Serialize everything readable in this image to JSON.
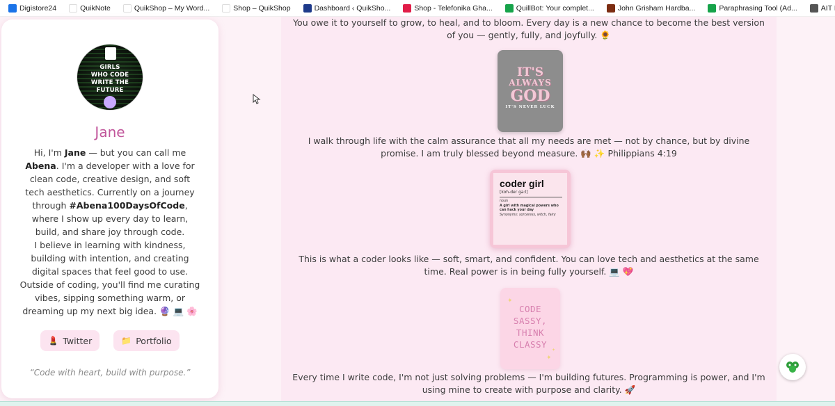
{
  "bookmarks": [
    {
      "label": "Digistore24",
      "icon": "digistore-icon",
      "color": "#1a73e8"
    },
    {
      "label": "QuikNote",
      "icon": "quiknote-icon",
      "color": "#ffffff"
    },
    {
      "label": "QuikShop – My Word...",
      "icon": "quikshop-icon",
      "color": "#ffffff"
    },
    {
      "label": "Shop – QuikShop",
      "icon": "shop-icon",
      "color": "#ffffff"
    },
    {
      "label": "Dashboard ‹ QuikSho...",
      "icon": "s-icon",
      "color": "#1e3a8a"
    },
    {
      "label": "Shop - Telefonika Gha...",
      "icon": "lips-icon",
      "color": "#e11d48"
    },
    {
      "label": "QuillBot: Your complet...",
      "icon": "quillbot-icon",
      "color": "#16a34a"
    },
    {
      "label": "John Grisham Hardba...",
      "icon": "book-icon",
      "color": "#7c2d12"
    },
    {
      "label": "Paraphrasing Tool (Ad...",
      "icon": "paraphrase-icon",
      "color": "#16a34a"
    },
    {
      "label": "AIT LEMASS",
      "icon": "globe-icon",
      "color": "#555555"
    }
  ],
  "profile": {
    "avatar_lines": [
      "GIRLS",
      "WHO CODE",
      "WRITE THE",
      "FUTURE"
    ],
    "name": "Jane",
    "bio": {
      "p1_a": "Hi, I'm ",
      "p1_b": "Jane",
      "p1_c": " — but you can call me ",
      "p1_d": "Abena",
      "p1_e": ". I'm a developer with a love for clean code, creative design, and soft tech aesthetics. Currently on a journey through ",
      "p1_f": "#Abena100DaysOfCode",
      "p1_g": ", where I show up every day to learn, build, and share joy through code.",
      "p2": "I believe in learning with kindness, building with intention, and creating digital spaces that feel good to use.",
      "p3": "Outside of coding, you'll find me curating vibes, sipping something warm, or dreaming up my next big idea. 🔮 💻 🌸"
    },
    "links": [
      {
        "label": "Twitter",
        "icon": "💄"
      },
      {
        "label": "Portfolio",
        "icon": "📁"
      }
    ],
    "quote": "“Code with heart, build with purpose.”"
  },
  "feed": {
    "post1": "You owe it to yourself to grow, to heal, and to bloom. Every day is a new chance to become the best version of you — gently, fully, and joyfully. 🌻",
    "img1": {
      "l1": "IT'S",
      "l2": "ALWAYS",
      "l3": "GOD",
      "l4": "IT'S NEVER LUCK"
    },
    "post2": "I walk through life with the calm assurance that all my needs are met — not by chance, but by divine promise. I am truly blessed beyond measure. 🙌🏾 ✨ Philippians 4:19",
    "img2": {
      "title": "coder girl",
      "pron": "[koh-der gə:l]",
      "pos": "noun",
      "def": "A girl with magical powers who can hack your day",
      "syn": "Synonyms: sorceress, witch, fairy"
    },
    "post3": "This is what a coder looks like — soft, smart, and confident. You can love tech and aesthetics at the same time. Real power is in being fully yourself. 💻 💖",
    "img3": {
      "l1": "CODE",
      "l2": "SASSY,",
      "l3": "THINK",
      "l4": "CLASSY"
    },
    "post4": "Every time I write code, I'm not just solving problems — I'm building futures. Programming is power, and I'm using mine to create with purpose and clarity. 🚀"
  },
  "colors": {
    "accent": "#c1569b",
    "page_bg": "#fdf2f7",
    "button_bg": "#fce4f0"
  }
}
